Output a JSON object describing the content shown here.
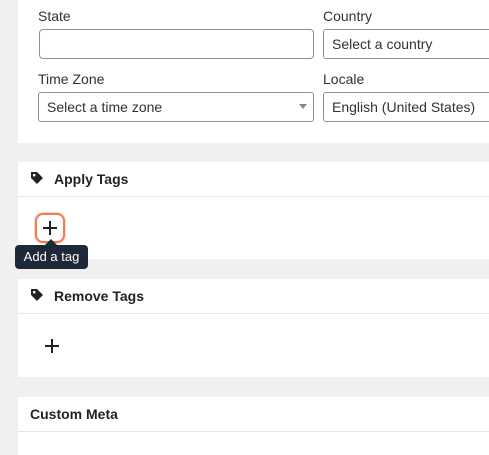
{
  "address": {
    "state_label": "State",
    "state_value": "",
    "country_label": "Country",
    "country_value": "Select a country",
    "timezone_label": "Time Zone",
    "timezone_value": "Select a time zone",
    "locale_label": "Locale",
    "locale_value": "English (United States)"
  },
  "apply_tags": {
    "title": "Apply Tags",
    "icon": "tag-icon",
    "add_icon": "plus-icon",
    "tooltip": "Add a tag"
  },
  "remove_tags": {
    "title": "Remove Tags",
    "icon": "tag-icon",
    "add_icon": "plus-icon"
  },
  "custom_meta": {
    "title": "Custom Meta"
  },
  "colors": {
    "focus_ring": "#ef7e56",
    "tooltip_bg": "#1d2838",
    "page_bg": "#f0f0f1"
  }
}
